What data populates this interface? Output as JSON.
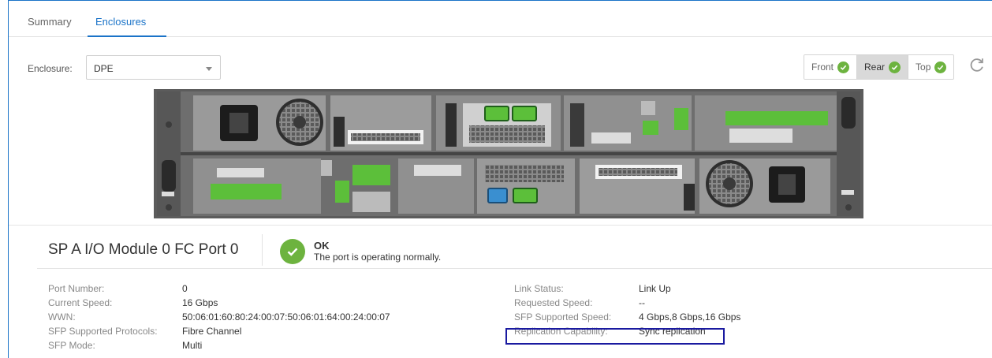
{
  "tabs": [
    {
      "label": "Summary"
    },
    {
      "label": "Enclosures"
    }
  ],
  "enclosure": {
    "label": "Enclosure:",
    "selected": "DPE"
  },
  "views": [
    {
      "label": "Front",
      "active": false
    },
    {
      "label": "Rear",
      "active": true
    },
    {
      "label": "Top",
      "active": false
    }
  ],
  "icons": {
    "status": "check-circle-icon",
    "refresh": "refresh-icon",
    "dropdown": "chevron-down-icon"
  },
  "colors": {
    "accent": "#1a73c8",
    "ok": "#6db33f",
    "port_green": "#5cbf3a",
    "highlight_box": "#1a1aa0"
  },
  "detail": {
    "title": "SP A I/O Module 0 FC Port 0",
    "status_title": "OK",
    "status_desc": "The port is operating normally.",
    "left_fields": [
      {
        "key": "Port Number:",
        "value": "0"
      },
      {
        "key": "Current Speed:",
        "value": "16 Gbps"
      },
      {
        "key": "WWN:",
        "value": "50:06:01:60:80:24:00:07:50:06:01:64:00:24:00:07"
      },
      {
        "key": "SFP Supported Protocols:",
        "value": "Fibre Channel"
      },
      {
        "key": "SFP Mode:",
        "value": "Multi"
      }
    ],
    "right_fields": [
      {
        "key": "Link Status:",
        "value": "Link Up"
      },
      {
        "key": "Requested Speed:",
        "value": "--"
      },
      {
        "key": "SFP Supported Speed:",
        "value": "4 Gbps,8 Gbps,16 Gbps"
      },
      {
        "key": "Replication Capability:",
        "value": "Sync replication"
      }
    ]
  }
}
